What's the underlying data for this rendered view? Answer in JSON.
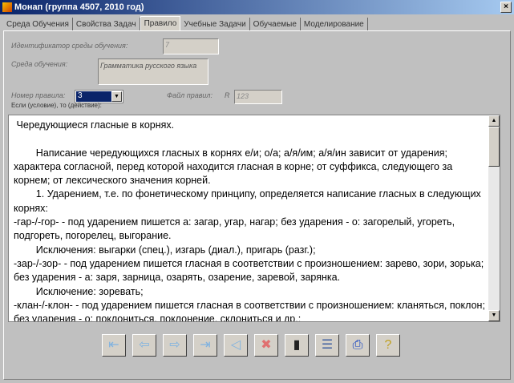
{
  "window": {
    "title": "Монап (группа 4507, 2010 год)",
    "close": "×"
  },
  "tabs": [
    "Среда Обучения",
    "Свойства Задач",
    "Правило",
    "Учебные Задачи",
    "Обучаемые",
    "Моделирование"
  ],
  "form": {
    "env_id_label": "Идентификатор среды обучения:",
    "env_id_value": "7",
    "env_label": "Среда обучения:",
    "env_value": "Грамматика русского языка",
    "rule_no_label": "Номер правила:",
    "rule_no_value": "3",
    "rule_file_label": "Файл правил:",
    "rule_file_prefix": "R",
    "rule_file_value": "123",
    "ifthen_label": "Если (условие), то (действие):"
  },
  "rule_text": " Чередующиеся гласные в корнях.\n\n        Написание чередующихся гласных в корнях е/и; о/а; а/я/им; а/я/ин зависит от ударения; характера согласной, перед которой находится гласная в корне; от суффикса, следующего за корнем; от лексического значения корней.\n        1. Ударением, т.е. по фонетическому принципу, определяется написание гласных в следующих корнях:\n-гар-/-гор- - под ударением пишется а: загар, угар, нагар; без ударения - о: загорелый, угореть, подгореть, погорелец, выгорание.\n        Исключения: выгарки (спец.), изгарь (диал.), пригарь (разг.);\n-зар-/-зор- - под ударением пишется гласная в соответствии с произношением: зарево, зори, зорька; без ударения - а: заря, зарница, озарять, озарение, заревой, зарянка.\n        Исключение: зоревать;\n-клан-/-клон- - под ударением пишется гласная в соответствии с произношением: кланяться, поклон; без ударения - о: поклониться, поклонение, склониться и др.;",
  "toolbar": [
    {
      "name": "first-record",
      "glyph": "⇤",
      "color": "#7fb2e0"
    },
    {
      "name": "previous-record",
      "glyph": "⇦",
      "color": "#7fb2e0"
    },
    {
      "name": "next-record",
      "glyph": "⇨",
      "color": "#7fb2e0"
    },
    {
      "name": "last-record",
      "glyph": "⇥",
      "color": "#7fb2e0"
    },
    {
      "name": "new-record",
      "glyph": "◁",
      "color": "#7fb2e0"
    },
    {
      "name": "delete-record",
      "glyph": "✖",
      "color": "#e07070"
    },
    {
      "name": "save",
      "glyph": "▮",
      "color": "#222222"
    },
    {
      "name": "document",
      "glyph": "☰",
      "color": "#4060a0"
    },
    {
      "name": "print",
      "glyph": "⎙",
      "color": "#1040c0"
    },
    {
      "name": "help",
      "glyph": "?",
      "color": "#c0a020"
    }
  ]
}
